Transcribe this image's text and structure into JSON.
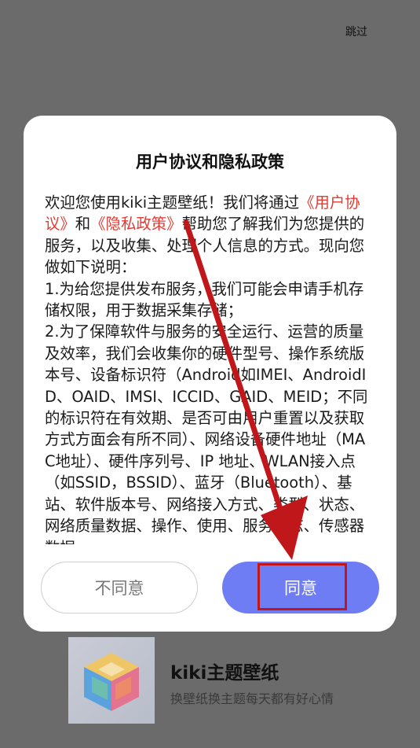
{
  "skip_label": "跳过",
  "dialog": {
    "title": "用户协议和隐私政策",
    "body": {
      "intro": "欢迎您使用kiki主题壁纸！我们将通过",
      "link_user_agreement": "《用户协议》",
      "and": "和",
      "link_privacy_policy": "《隐私政策》",
      "after_links": "帮助您了解我们为您提供的服务，以及收集、处理个人信息的方式。现向您做如下说明：\n1.为给您提供发布服务，我们可能会申请手机存储权限，用于数据采集存储；\n2.为了保障软件与服务的安全运行、运营的质量及效率，我们会收集你的硬件型号、操作系统版本号、设备标识符（Android如IMEI、AndroidID、OAID、IMSI、ICCID、GAID、MEID；不同的标识符在有效期、是否可由用户重置以及获取方式方面会有所不同）、网络设备硬件地址（MAC地址）、硬件序列号、IP 地址、WLAN接入点（如SSID，BSSID）、蓝牙（Bluetooth）、基站、软件版本号、网络接入方式、类型、状态、网络质量数据、操作、使用、服务日志、传感器数据"
    },
    "disagree_label": "不同意",
    "agree_label": "同意"
  },
  "app": {
    "name": "kiki主题壁纸",
    "slogan": "换壁纸换主题每天都有好心情"
  },
  "colors": {
    "overlay": "#6b6b6b",
    "link": "#e33b33",
    "agree_button": "#6f7df5",
    "annotation": "#c0171a"
  }
}
